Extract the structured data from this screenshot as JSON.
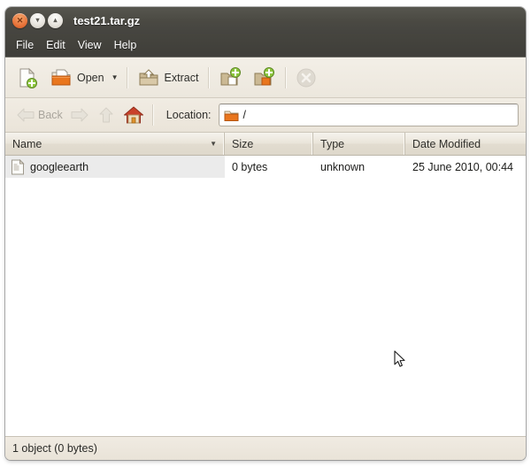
{
  "window": {
    "title": "test21.tar.gz",
    "controls": [
      {
        "name": "close",
        "glyph": "✕"
      },
      {
        "name": "minimize",
        "glyph": "▾"
      },
      {
        "name": "maximize",
        "glyph": "▴"
      }
    ]
  },
  "menubar": {
    "items": [
      {
        "label": "File"
      },
      {
        "label": "Edit"
      },
      {
        "label": "View"
      },
      {
        "label": "Help"
      }
    ]
  },
  "toolbar": {
    "new_label": "",
    "open_label": "Open",
    "open_dropdown_glyph": "▼",
    "extract_label": "Extract",
    "add_files_label": "",
    "add_folder_label": "",
    "stop_label": ""
  },
  "locationbar": {
    "back_label": "Back",
    "forward_label": "",
    "up_label": "",
    "home_label": "",
    "location_label": "Location:",
    "location_value": "/"
  },
  "filelist": {
    "columns": [
      {
        "label": "Name",
        "sort_indicator": "▼"
      },
      {
        "label": "Size",
        "sort_indicator": ""
      },
      {
        "label": "Type",
        "sort_indicator": ""
      },
      {
        "label": "Date Modified",
        "sort_indicator": ""
      }
    ],
    "rows": [
      {
        "name": "googleearth",
        "size": "0 bytes",
        "type": "unknown",
        "date_modified": "25 June 2010, 00:44"
      }
    ]
  },
  "statusbar": {
    "text": "1 object (0 bytes)"
  },
  "colors": {
    "titlebar": "#4a4942",
    "toolbar": "#efeae1",
    "accent_orange": "#e8743b",
    "row_highlight": "#ebebeb",
    "folder_orange": "#e9761e",
    "plus_green": "#8ec63f"
  }
}
